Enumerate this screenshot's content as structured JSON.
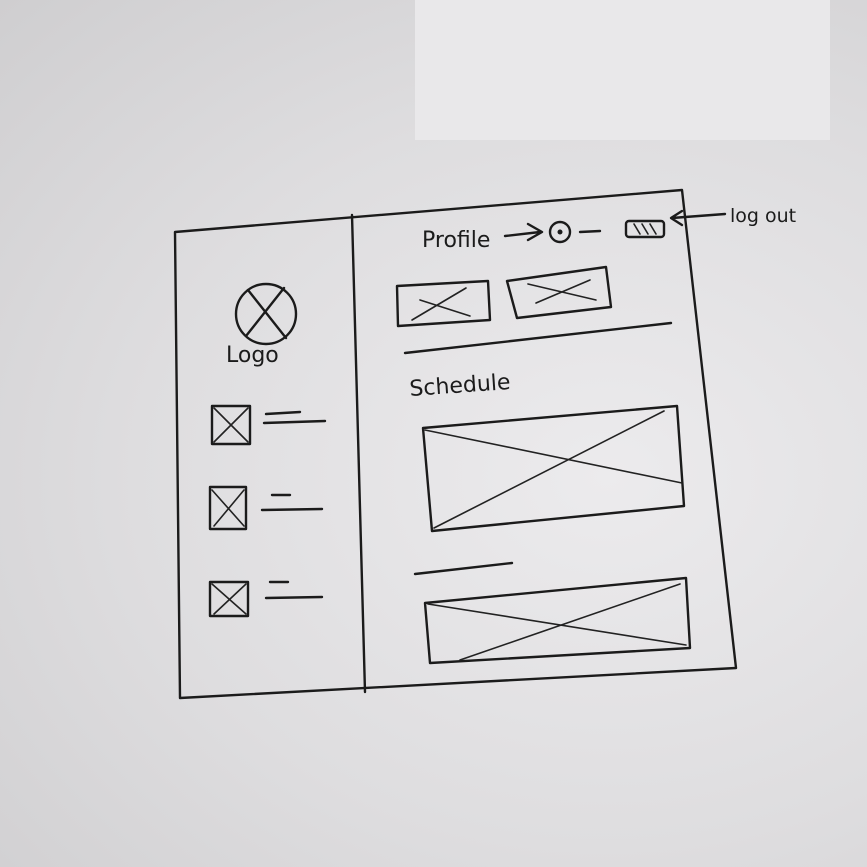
{
  "sidebar": {
    "logo_label": "Logo",
    "nav_items": [
      {
        "icon": "image-placeholder"
      },
      {
        "icon": "image-placeholder"
      },
      {
        "icon": "image-placeholder"
      }
    ]
  },
  "header": {
    "profile_label": "Profile",
    "logout_label": "log out"
  },
  "main": {
    "schedule_label": "Schedule"
  }
}
